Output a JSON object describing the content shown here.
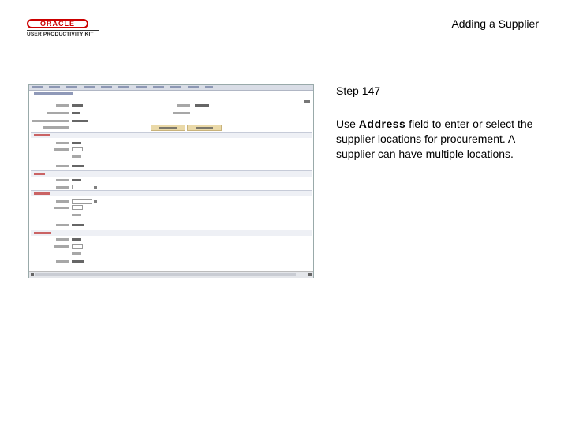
{
  "header": {
    "logo_brand": "ORACLE",
    "logo_subtitle": "USER PRODUCTIVITY KIT",
    "title": "Adding a Supplier"
  },
  "step": {
    "label": "Step 147"
  },
  "instruction": {
    "prefix": "Use ",
    "field": "Address",
    "suffix": " field to enter or select the supplier locations for procurement. A supplier can have multiple locations."
  },
  "screenshot": {
    "icon": "form-screenshot-thumbnail"
  }
}
